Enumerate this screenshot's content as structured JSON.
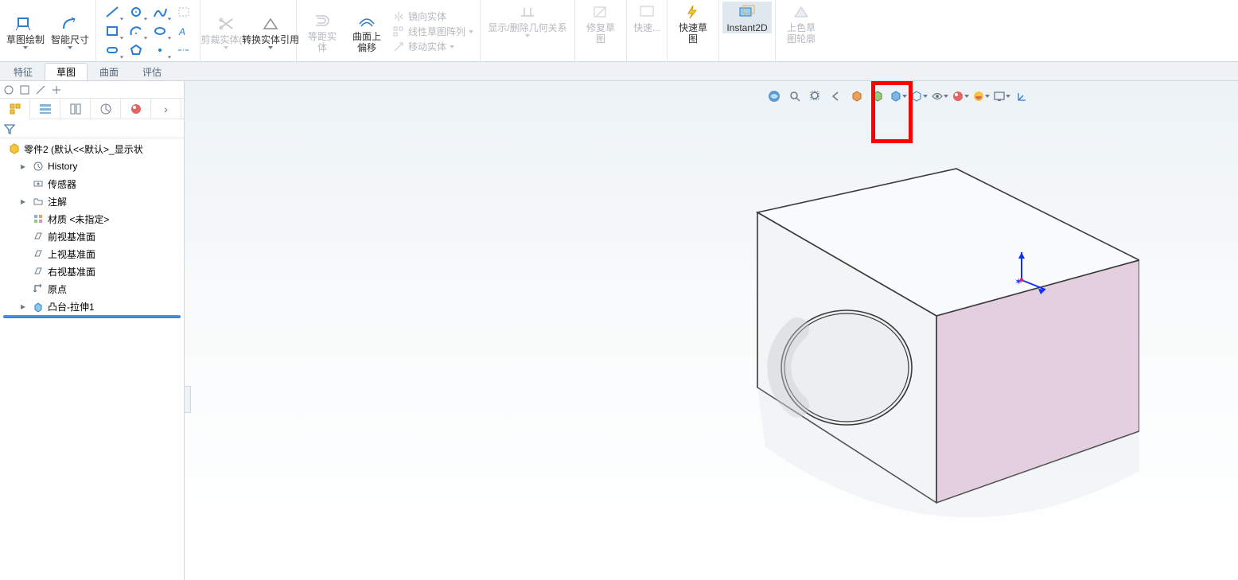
{
  "ribbon": {
    "sketch_draw": "草图绘制",
    "smart_dim": "智能尺寸",
    "trim": "剪裁实体(T)",
    "convert": "转换实体引用",
    "offset_a": "等距实\n体",
    "offset_b": "曲面上\n偏移",
    "mirror": "镜向实体",
    "pattern": "线性草图阵列",
    "move": "移动实体",
    "relations": "显示/删除几何关系",
    "repair": "修复草\n图",
    "quick": "快速...",
    "rapid": "快速草\n图",
    "instant2d": "Instant2D",
    "shade": "上色草\n图轮廓"
  },
  "cmdTabs": [
    "特征",
    "草图",
    "曲面",
    "评估"
  ],
  "cmdActive": 1,
  "tree": {
    "root": "零件2 (默认<<默认>_显示状",
    "rows": [
      {
        "exp": "▸",
        "icon": "history",
        "label": "History"
      },
      {
        "exp": "",
        "icon": "sensor",
        "label": "传感器"
      },
      {
        "exp": "▸",
        "icon": "folder",
        "label": "注解"
      },
      {
        "exp": "",
        "icon": "material",
        "label": "材质 <未指定>"
      },
      {
        "exp": "",
        "icon": "plane",
        "label": "前视基准面"
      },
      {
        "exp": "",
        "icon": "plane",
        "label": "上视基准面"
      },
      {
        "exp": "",
        "icon": "plane",
        "label": "右视基准面"
      },
      {
        "exp": "",
        "icon": "origin",
        "label": "原点"
      },
      {
        "exp": "▸",
        "icon": "extrude",
        "label": "凸台-拉伸1"
      }
    ]
  }
}
